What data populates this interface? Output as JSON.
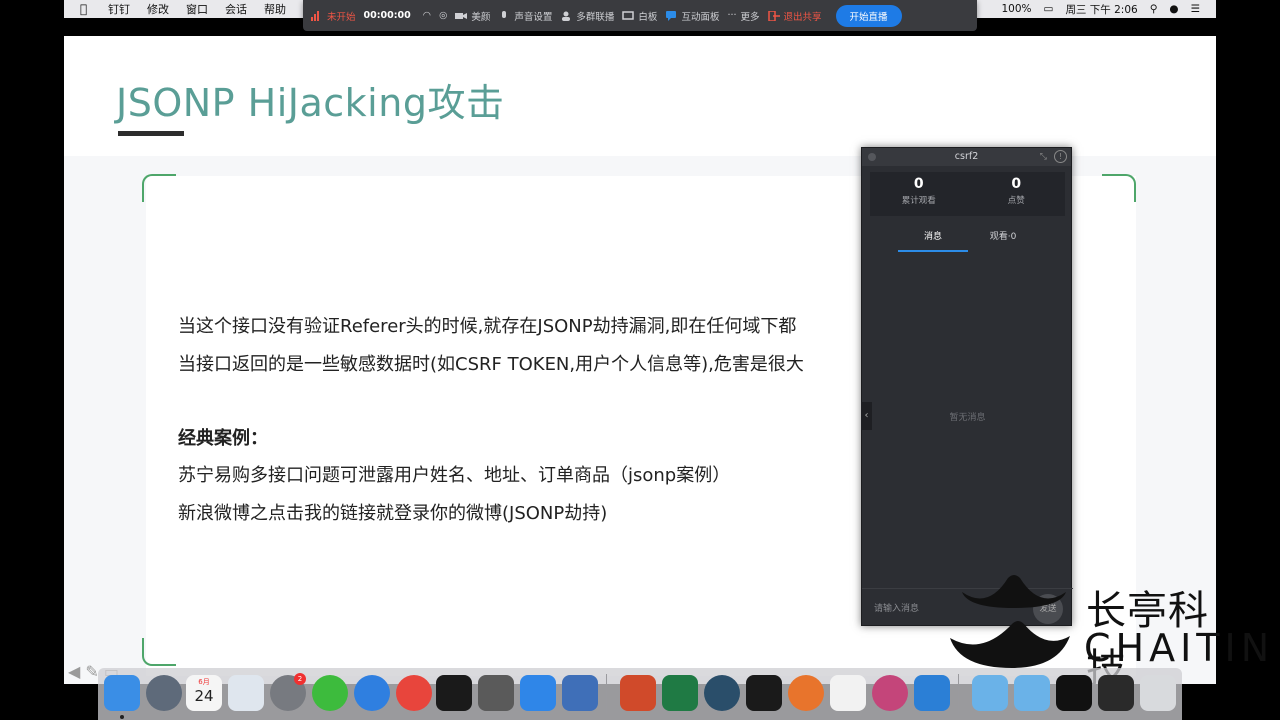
{
  "menubar": {
    "apple_icon": "apple-icon",
    "items": [
      "钉钉",
      "修改",
      "窗口",
      "会话",
      "帮助"
    ],
    "battery": "100%",
    "clock": "周三 下午 2:06"
  },
  "toolbar": {
    "status": "未开始",
    "timer": "00:00:00",
    "beauty": "美颜",
    "audio_settings": "声音设置",
    "multi_group": "多群联播",
    "whiteboard": "白板",
    "interactive_panel": "互动面板",
    "more": "更多",
    "exit_share": "退出共享",
    "start_live": "开始直播"
  },
  "slide": {
    "title": "JSONP HiJacking攻击",
    "para1": "当这个接口没有验证Referer头的时候,就存在JSONP劫持漏洞,即在任何域下都",
    "para2": "当接口返回的是一些敏感数据时(如CSRF TOKEN,用户个人信息等),危害是很大",
    "cases_heading": "经典案例：",
    "case1": "苏宁易购多接口问题可泄露用户姓名、地址、订单商品（jsonp案例）",
    "case2": "新浪微博之点击我的链接就登录你的微博(JSONP劫持)"
  },
  "panel": {
    "title": "csrf2",
    "views_count": "0",
    "views_label": "累计观看",
    "likes_count": "0",
    "likes_label": "点赞",
    "tab_messages": "消息",
    "tab_viewers": "观看·0",
    "empty_text": "暂无消息",
    "input_placeholder": "请输入消息",
    "send": "发送"
  },
  "logo": {
    "cn": "长亭科技",
    "en": "CHAITIN"
  },
  "dock": {
    "calendar_month": "6月",
    "calendar_day": "24",
    "prefs_badge": "2"
  },
  "colors": {
    "accent_green": "#4ea66a",
    "title_teal": "#5a9e96",
    "live_blue": "#1e7be6",
    "record_red": "#f05545"
  }
}
